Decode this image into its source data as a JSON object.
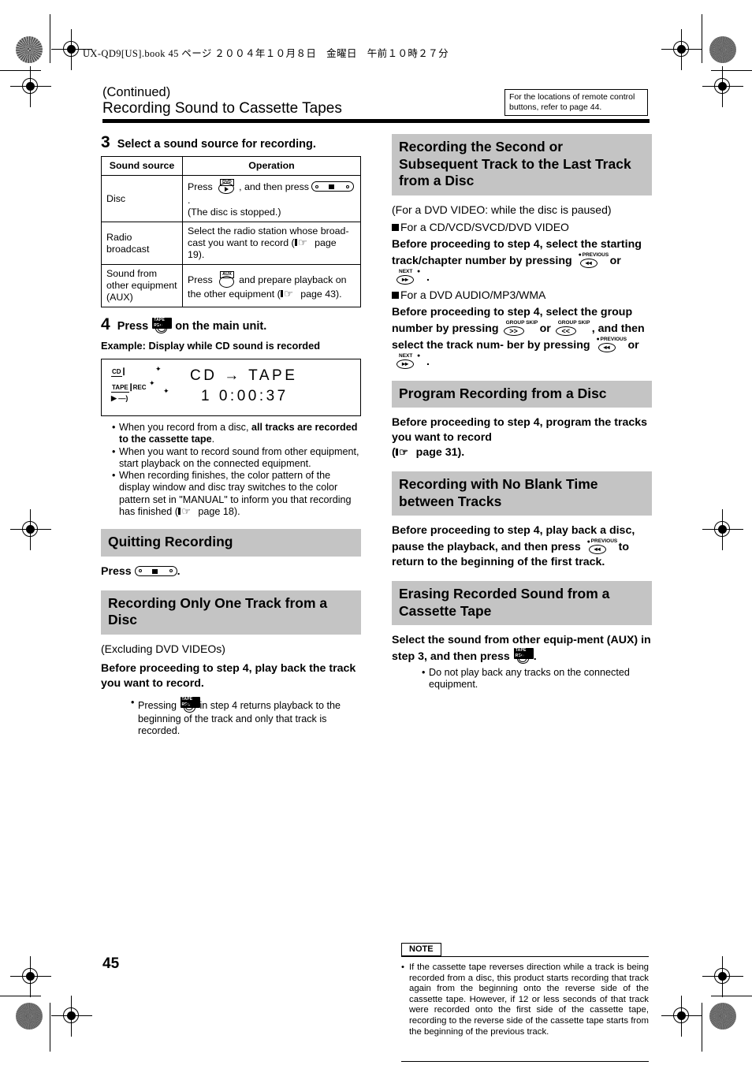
{
  "book_header": "UX-QD9[US].book  45 ページ  ２００４年１０月８日　金曜日　午前１０時２７分",
  "page_number": "45",
  "title": {
    "continued": "(Continued)",
    "main": "Recording Sound to Cassette Tapes"
  },
  "remote_note": "For the locations of remote control buttons, refer to page 44.",
  "left_column": {
    "step3": {
      "num": "3",
      "text": "Select a sound source for recording."
    },
    "table": {
      "headers": [
        "Sound source",
        "Operation"
      ],
      "rows": [
        {
          "source": "Disc",
          "op_pre": "Press",
          "op_mid": ", and then press",
          "op_post": ".",
          "op_line2": "(The disc is stopped.)",
          "icon1": "dvd-button-icon",
          "icon2": "stop-button-icon"
        },
        {
          "source": "Radio broadcast",
          "op_pre": "Select the radio station whose broad-cast you want to record (",
          "op_post": " page 19).",
          "icon1": "pointing-hand-icon"
        },
        {
          "source": "Sound from other equipment (AUX)",
          "op_pre": "Press",
          "op_mid": "and prepare playback on the other equipment (",
          "op_post": " page 43).",
          "icon1": "aux-button-icon",
          "icon2": "pointing-hand-icon"
        }
      ]
    },
    "step4": {
      "num": "4",
      "pre": "Press",
      "post": "on the main unit.",
      "icon": "tape-rec-button-icon"
    },
    "example_label": "Example: Display while CD sound is recorded",
    "display": {
      "indicator_cd": "CD",
      "indicator_tape": "TAPE",
      "indicator_rec": "REC",
      "line1": "CD  →  TAPE",
      "line2": "1  0:00:37"
    },
    "bullets": [
      "When you record from a disc, all tracks are recorded to the cassette tape.",
      "When you want to record sound from other equipment, start playback on the connected equipment.",
      "When recording finishes, the color pattern of the display window and disc tray switches to the color pattern set in \"MANUAL\" to inform you that recording has finished ( page 18)."
    ],
    "bullet1_plain_pre": "When you record from a disc, ",
    "bullet1_bold": "all tracks are recorded to the cassette tape",
    "bullet1_post": ".",
    "bullet3_pre": "When recording finishes, the color pattern of the display window and disc tray switches to the color pattern set in \"MANUAL\" to inform you that recording has finished (",
    "bullet3_post": " page 18).",
    "quitting": {
      "heading": "Quitting Recording",
      "press_label": "Press",
      "press_post": "."
    },
    "one_track": {
      "heading": "Recording Only One Track from a Disc",
      "subnote": "(Excluding DVD VIDEOs)",
      "bold": "Before proceeding to step 4, play back the track you want to record.",
      "bullet_pre": "Pressing",
      "bullet_post": "in step 4 returns playback to the beginning of the track and only that track is recorded."
    }
  },
  "right_column": {
    "second_track": {
      "heading": "Recording the Second or Subsequent Track to the Last Track from a Disc",
      "paren": "(For a DVD VIDEO: while the disc is paused)",
      "sub1": "For a CD/VCD/SVCD/DVD VIDEO",
      "bold1_a": "Before proceeding to step 4, select the starting track/chapter number by",
      "bold1_b": "pressing",
      "bold1_or": "or",
      "bold1_end": ".",
      "sub2": "For a DVD AUDIO/MP3/WMA",
      "bold2_a": "Before proceeding to step 4, select the",
      "bold2_b": "group number by pressing",
      "bold2_or": "or",
      "bold2_c": ", and then select the track num-",
      "bold2_d": "ber by pressing",
      "bold2_or2": "or",
      "bold2_end": "."
    },
    "program": {
      "heading": "Program Recording from a Disc",
      "bold_a": "Before proceeding to step 4, program the tracks you want to record",
      "bold_b_open": "(",
      "bold_b_post": " page 31)."
    },
    "no_blank": {
      "heading": "Recording with No Blank Time between Tracks",
      "bold_a": "Before proceeding to step 4, play back a disc, pause the playback, and then",
      "bold_b": "press",
      "bold_c": "to return to the beginning of the first track."
    },
    "erasing": {
      "heading": "Erasing Recorded Sound from a Cassette Tape",
      "bold_a": "Select the sound from other equip-ment (AUX) in step 3, and then press",
      "bold_dot": ".",
      "bullet": "Do not play back any tracks on the connected equipment."
    },
    "note": {
      "label": "NOTE",
      "text": "If the cassette tape reverses direction while a track is being recorded from a disc, this product starts recording that track again from the beginning onto the reverse side of the cassette tape. However, if 12 or less seconds of that track were recorded onto the first side of the cassette tape, recording to the reverse side of the cassette tape starts from the beginning of the previous track."
    }
  },
  "icons": {
    "prev_cap": "PREVIOUS",
    "next_cap": "NEXT",
    "group_skip_cap": "GROUP SKIP",
    "prev_glyph": "◂◂",
    "next_glyph": "▸▸",
    "group_fwd_glyph": ">>",
    "group_back_glyph": "<<",
    "dvd_cap": "DVD",
    "aux_cap": "AUX",
    "tape_rec_cap": "TAPE REC"
  },
  "colors": {
    "section_bar": "#c4c4c4",
    "rule": "#000000"
  }
}
